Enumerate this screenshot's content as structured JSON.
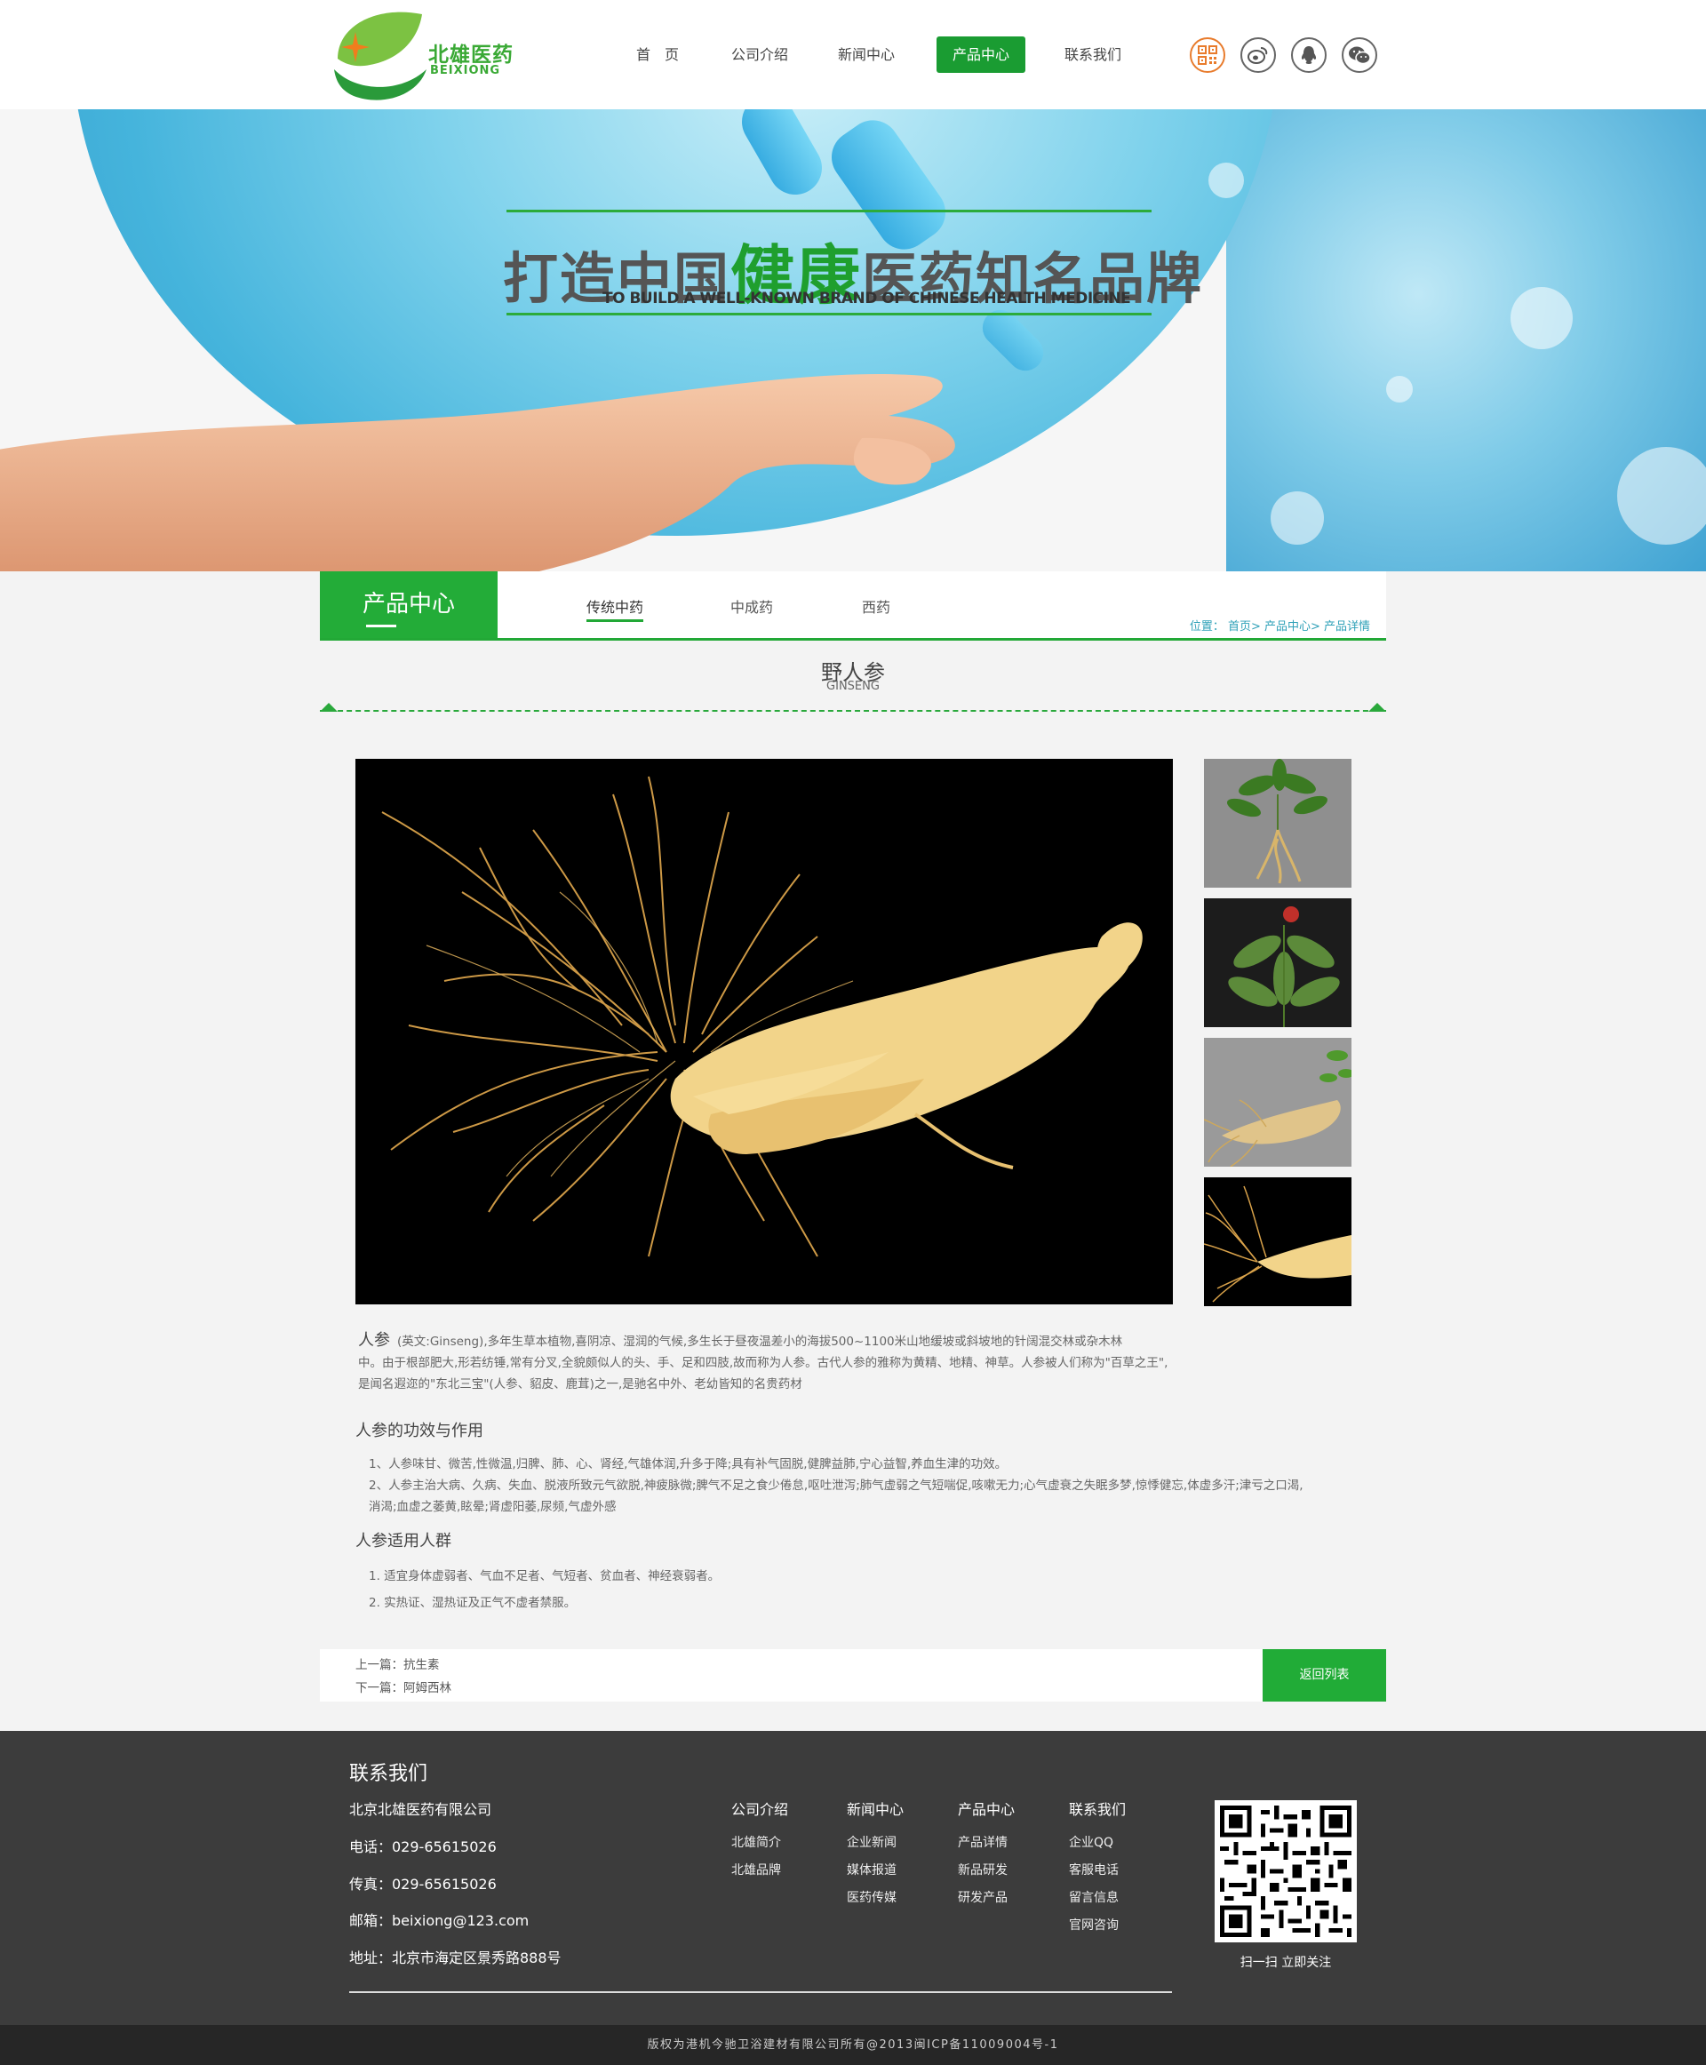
{
  "header": {
    "logo_cn": "北雄医药",
    "logo_en": "BEIXIONG",
    "nav": [
      {
        "label": "首　页"
      },
      {
        "label": "公司介绍"
      },
      {
        "label": "新闻中心"
      },
      {
        "label": "产品中心"
      },
      {
        "label": "联系我们"
      }
    ],
    "active_nav": "产品中心",
    "social_icons": [
      "qrcode-icon",
      "weibo-icon",
      "qq-icon",
      "wechat-icon"
    ]
  },
  "banner": {
    "slogan_pre": "打造中国",
    "slogan_hl": "健康",
    "slogan_post": "医药知名品牌",
    "slogan_en": "TO BUILD A WELL-KNOWN BRAND OF CHINESE HEALTH MEDICINE"
  },
  "subnav": {
    "title": "产品中心",
    "tabs": [
      "传统中药",
      "中成药",
      "西药"
    ],
    "active_tab": "传统中药",
    "breadcrumb": "位置： 首页> 产品中心> 产品详情"
  },
  "product": {
    "title": "野人参",
    "title_en": "GINSENG",
    "intro_term": "人参",
    "intro_line1": "(英文:Ginseng),多年生草本植物,喜阴凉、湿润的气候,多生长于昼夜温差小的海拔500~1100米山地缓坡或斜坡地的针阔混交林或杂木林",
    "intro_line2": "中。由于根部肥大,形若纺锤,常有分叉,全貌颇似人的头、手、足和四肢,故而称为人参。古代人参的雅称为黄精、地精、神草。人参被人们称为\"百草之王\",",
    "intro_line3": "是闻名遐迩的\"东北三宝\"(人参、貂皮、鹿茸)之一,是驰名中外、老幼皆知的名贵药材",
    "effects_title": "人参的功效与作用",
    "effects": [
      "1、人参味甘、微苦,性微温,归脾、肺、心、肾经,气雄体润,升多于降;具有补气固脱,健脾益肺,宁心益智,养血生津的功效。",
      "2、人参主治大病、久病、失血、脱液所致元气欲脱,神疲脉微;脾气不足之食少倦怠,呕吐泄泻;肺气虚弱之气短喘促,咳嗽无力;心气虚衰之失眠多梦,惊悸健忘,体虚多汗;津亏之口渴,",
      "消渴;血虚之萎黄,眩晕;肾虚阳萎,尿频,气虚外感"
    ],
    "people_title": "人参适用人群",
    "people": [
      "1. 适宜身体虚弱者、气血不足者、气短者、贫血者、神经衰弱者。",
      "2. 实热证、湿热证及正气不虚者禁服。"
    ]
  },
  "pager": {
    "prev": "上一篇：抗生素",
    "next": "下一篇：阿姆西林",
    "back": "返回列表"
  },
  "footer": {
    "contact_title": "联系我们",
    "company": "北京北雄医药有限公司",
    "phone": "电话：029-65615026",
    "fax": "传真：029-65615026",
    "email": "邮箱：beixiong@123.com",
    "address": "地址：北京市海定区景秀路888号",
    "columns": [
      {
        "title": "公司介绍",
        "items": [
          "北雄简介",
          "北雄品牌"
        ]
      },
      {
        "title": "新闻中心",
        "items": [
          "企业新闻",
          "媒体报道",
          "医药传媒"
        ]
      },
      {
        "title": "产品中心",
        "items": [
          "产品详情",
          "新品研发",
          "研发产品"
        ]
      },
      {
        "title": "联系我们",
        "items": [
          "企业QQ",
          "客服电话",
          "留言信息",
          "官网咨询"
        ]
      }
    ],
    "qr_caption": "扫一扫  立即关注",
    "copyright": "版权为港机今驰卫浴建材有限公司所有@2013闽ICP备11009004号-1"
  },
  "colors": {
    "brand_green": "#23ac38",
    "footer_bg": "#3c3c3c",
    "copyright_bg": "#262626",
    "breadcrumb": "#2fa1b8"
  }
}
